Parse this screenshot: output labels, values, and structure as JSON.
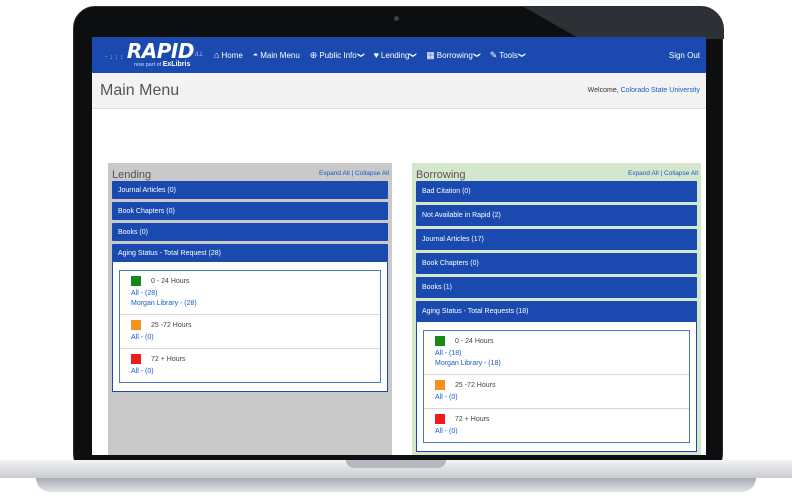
{
  "nav": {
    "logo_main": "RAPID",
    "logo_dots": "·:::",
    "logo_ill": "ILL",
    "logo_sub": "now part of",
    "logo_brand": "ExLibris",
    "items": [
      {
        "label": "Home",
        "icon": "home-icon",
        "glyph": "⌂",
        "has_menu": false
      },
      {
        "label": "Main Menu",
        "icon": "dashboard-icon",
        "glyph": "◓",
        "has_menu": false
      },
      {
        "label": "Public Info",
        "icon": "globe-icon",
        "glyph": "⊕",
        "has_menu": true
      },
      {
        "label": "Lending",
        "icon": "heart-icon",
        "glyph": "♥",
        "has_menu": true
      },
      {
        "label": "Borrowing",
        "icon": "grid-icon",
        "glyph": "▦",
        "has_menu": true
      },
      {
        "label": "Tools",
        "icon": "wrench-icon",
        "glyph": "✎",
        "has_menu": true
      }
    ],
    "chevron": "❯",
    "sign_out": "Sign Out"
  },
  "header": {
    "title": "Main Menu",
    "welcome_prefix": "Welcome,",
    "welcome_user": "Colorado State University"
  },
  "lending": {
    "title": "Lending",
    "expand_all": "Expand All",
    "separator": "|",
    "collapse_all": "Collapse All",
    "bars": [
      "Journal Articles (0)",
      "Book Chapters (0)",
      "Books (0)"
    ],
    "aging_title": "Aging Status - Total Request (28)",
    "aging": [
      {
        "label": "0 - 24 Hours",
        "color": "#168a16",
        "links": [
          "All - (28)",
          "Morgan Library - (28)"
        ]
      },
      {
        "label": "25 -72 Hours",
        "color": "#f5921e",
        "links": [
          "All - (0)"
        ]
      },
      {
        "label": "72 + Hours",
        "color": "#ee1c1c",
        "links": [
          "All - (0)"
        ]
      }
    ]
  },
  "borrowing": {
    "title": "Borrowing",
    "expand_all": "Expand All",
    "separator": "|",
    "collapse_all": "Collapse All",
    "bars": [
      "Bad Citation (0)",
      "Not Available in Rapid (2)",
      "Journal Articles (17)",
      "Book Chapters (0)",
      "Books (1)"
    ],
    "aging_title": "Aging Status - Total Requests (18)",
    "aging": [
      {
        "label": "0 - 24 Hours",
        "color": "#168a16",
        "links": [
          "All - (18)",
          "Morgan Library - (18)"
        ]
      },
      {
        "label": "25 -72 Hours",
        "color": "#f5921e",
        "links": [
          "All - (0)"
        ]
      },
      {
        "label": "72 + Hours",
        "color": "#ee1c1c",
        "links": [
          "All - (0)"
        ]
      }
    ]
  }
}
